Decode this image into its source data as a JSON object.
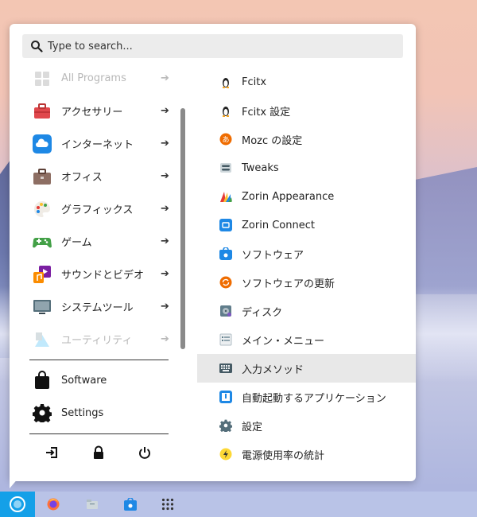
{
  "search": {
    "placeholder": "Type to search..."
  },
  "categories": [
    {
      "label": "All Programs",
      "dim": true
    },
    {
      "label": "アクセサリー"
    },
    {
      "label": "インターネット"
    },
    {
      "label": "オフィス"
    },
    {
      "label": "グラフィックス"
    },
    {
      "label": "ゲーム"
    },
    {
      "label": "サウンドとビデオ"
    },
    {
      "label": "システムツール"
    },
    {
      "label": "ユーティリティ",
      "dim": true
    }
  ],
  "bottom": {
    "software": "Software",
    "settings": "Settings"
  },
  "apps": [
    {
      "label": "Fcitx",
      "icon": "penguin-icon"
    },
    {
      "label": "Fcitx 設定",
      "icon": "penguin-icon"
    },
    {
      "label": "Mozc の設定",
      "icon": "mozc-icon"
    },
    {
      "label": "Tweaks",
      "icon": "tweaks-icon"
    },
    {
      "label": "Zorin Appearance",
      "icon": "appearance-icon"
    },
    {
      "label": "Zorin Connect",
      "icon": "connect-icon"
    },
    {
      "label": "ソフトウェア",
      "icon": "software-bag-icon"
    },
    {
      "label": "ソフトウェアの更新",
      "icon": "update-icon"
    },
    {
      "label": "ディスク",
      "icon": "disk-icon"
    },
    {
      "label": "メイン・メニュー",
      "icon": "menu-editor-icon"
    },
    {
      "label": "入力メソッド",
      "icon": "keyboard-icon",
      "selected": true
    },
    {
      "label": "自動起動するアプリケーション",
      "icon": "startup-icon"
    },
    {
      "label": "設定",
      "icon": "gear-icon"
    },
    {
      "label": "電源使用率の統計",
      "icon": "power-stats-icon"
    }
  ],
  "colors": {
    "accent": "#14a0e8",
    "taskbar": "#b9c3e7",
    "selection": "#e8e8e8"
  }
}
